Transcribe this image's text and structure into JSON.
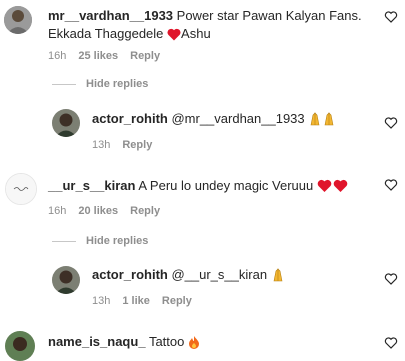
{
  "comments": [
    {
      "username": "mr__vardhan__1933",
      "text": "Power star Pawan Kalyan Fans. Ekkada Thaggedele",
      "text_tail": "Ashu",
      "time": "16h",
      "likes": "25 likes",
      "reply": "Reply",
      "hide_replies": "Hide replies"
    },
    {
      "username": "actor_rohith",
      "text": "@mr__vardhan__1933",
      "time": "13h",
      "reply": "Reply"
    },
    {
      "username": "__ur_s__kiran",
      "text": "A Peru lo undey magic Veruuu",
      "time": "16h",
      "likes": "20 likes",
      "reply": "Reply",
      "hide_replies": "Hide replies"
    },
    {
      "username": "actor_rohith",
      "text": "@__ur_s__kiran",
      "time": "13h",
      "likes": "1 like",
      "reply": "Reply"
    },
    {
      "username": "name_is_naqu_",
      "text": "Tattoo"
    }
  ],
  "colors": {
    "heart_red": "#e0152b",
    "text": "#262626",
    "muted": "#8e8e8e"
  }
}
